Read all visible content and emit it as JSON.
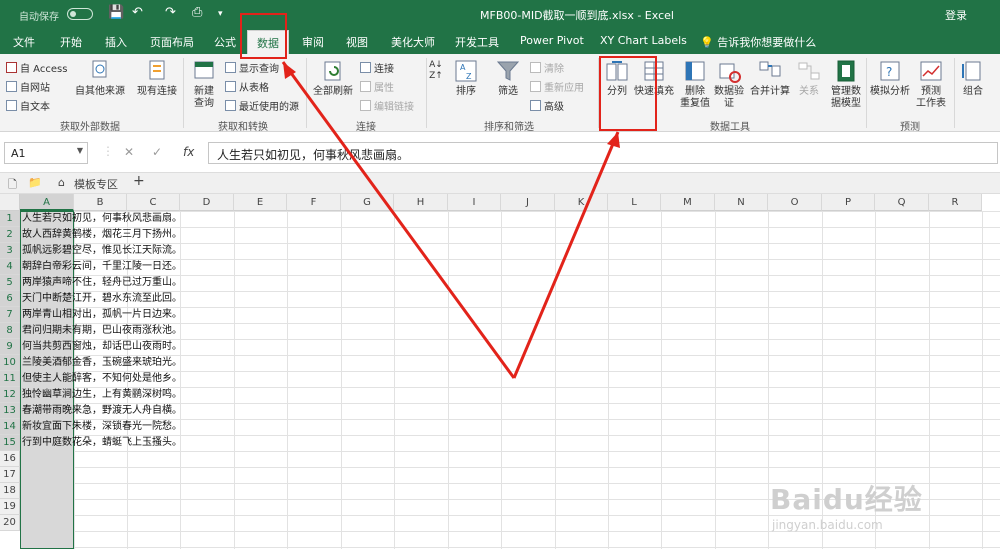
{
  "titlebar": {
    "autosave": "自动保存",
    "autosave_state": "关",
    "document_title": "MFB00-MID截取一顺到底.xlsx - Excel",
    "login": "登录"
  },
  "tabs": [
    "文件",
    "开始",
    "插入",
    "页面布局",
    "公式",
    "数据",
    "审阅",
    "视图",
    "美化大师",
    "开发工具",
    "Power Pivot",
    "XY Chart Labels"
  ],
  "active_tab": "数据",
  "tell_me": "告诉我你想要做什么",
  "ribbon": {
    "get_external": {
      "access": "自 Access",
      "web": "自网站",
      "text": "自文本",
      "other": "自其他来源",
      "existing": "现有连接",
      "label": "获取外部数据"
    },
    "get_transform": {
      "new_query": "新建\n查询",
      "show_queries": "显示查询",
      "from_table": "从表格",
      "recent": "最近使用的源",
      "label": "获取和转换"
    },
    "connections": {
      "refresh_all": "全部刷新",
      "connections": "连接",
      "properties": "属性",
      "edit_links": "编辑链接",
      "label": "连接"
    },
    "sort_filter": {
      "sort": "排序",
      "filter": "筛选",
      "clear": "清除",
      "reapply": "重新应用",
      "advanced": "高级",
      "label": "排序和筛选"
    },
    "data_tools": {
      "text_to_columns": "分列",
      "flash_fill": "快速填充",
      "remove_dup": "删除\n重复值",
      "validation": "数据验\n证",
      "consolidate": "合并计算",
      "relationships": "关系",
      "manage_model": "管理数\n据模型",
      "label": "数据工具"
    },
    "forecast": {
      "what_if": "模拟分析",
      "forecast_sheet": "预测\n工作表",
      "label": "预测"
    },
    "outline": {
      "group": "组合"
    }
  },
  "formula_bar": {
    "name_box": "A1",
    "fx": "fx",
    "formula": "人生若只如初见，何事秋风悲画扇。"
  },
  "sheet_tab": "模板专区",
  "columns": [
    "A",
    "B",
    "C",
    "D",
    "E",
    "F",
    "G",
    "H",
    "I",
    "J",
    "K",
    "L",
    "M",
    "N",
    "O",
    "P",
    "Q",
    "R"
  ],
  "rows": [
    "1",
    "2",
    "3",
    "4",
    "5",
    "6",
    "7",
    "8",
    "9",
    "10",
    "11",
    "12",
    "13",
    "14",
    "15",
    "16",
    "17",
    "18",
    "19",
    "20"
  ],
  "cells": [
    "人生若只如初见，何事秋风悲画扇。",
    "故人西辞黄鹤楼，烟花三月下扬州。",
    "孤帆远影碧空尽，惟见长江天际流。",
    "朝辞白帝彩云间，千里江陵一日还。",
    "两岸猿声啼不住，轻舟已过万重山。",
    "天门中断楚江开，碧水东流至此回。",
    "两岸青山相对出，孤帆一片日边来。",
    "君问归期未有期，巴山夜雨涨秋池。",
    "何当共剪西窗烛，却话巴山夜雨时。",
    "兰陵美酒郁金香，玉碗盛来琥珀光。",
    "但使主人能醉客，不知何处是他乡。",
    "独怜幽草涧边生，上有黄鹂深树鸣。",
    "春潮带雨晚来急，野渡无人舟自横。",
    "新妆宜面下朱楼，深锁春光一院愁。",
    "行到中庭数花朵，蜻蜓飞上玉搔头。"
  ],
  "watermark": {
    "logo": "Baidu经验",
    "url": "jingyan.baidu.com"
  },
  "colors": {
    "excel_green": "#217346",
    "annotation_red": "#e2231a"
  }
}
